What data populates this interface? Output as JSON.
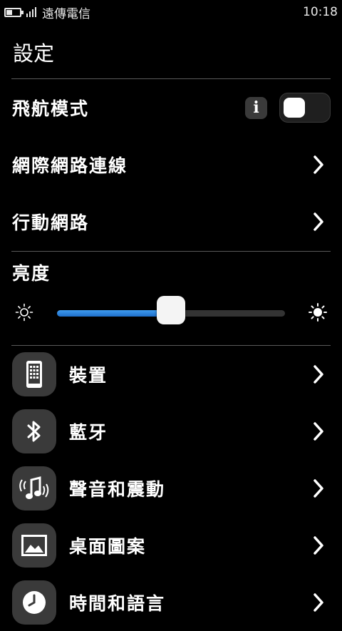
{
  "status_bar": {
    "carrier": "遠傳電信",
    "time": "10:18",
    "battery_level": 0.45,
    "signal_bars": 4
  },
  "title": "設定",
  "airplane_mode": {
    "label": "飛航模式",
    "info_icon": "info-icon",
    "toggle_on": false
  },
  "rows": [
    {
      "label": "網際網路連線"
    },
    {
      "label": "行動網路"
    }
  ],
  "brightness": {
    "label": "亮度",
    "level": 0.5
  },
  "settings_items": [
    {
      "label": "裝置",
      "icon": "device-icon"
    },
    {
      "label": "藍牙",
      "icon": "bluetooth-icon"
    },
    {
      "label": "聲音和震動",
      "icon": "music-note-icon"
    },
    {
      "label": "桌面圖案",
      "icon": "picture-icon"
    },
    {
      "label": "時間和語言",
      "icon": "clock-icon"
    }
  ],
  "colors": {
    "background": "#000000",
    "accent": "#2f86e0",
    "tile": "#3a3a3a"
  }
}
